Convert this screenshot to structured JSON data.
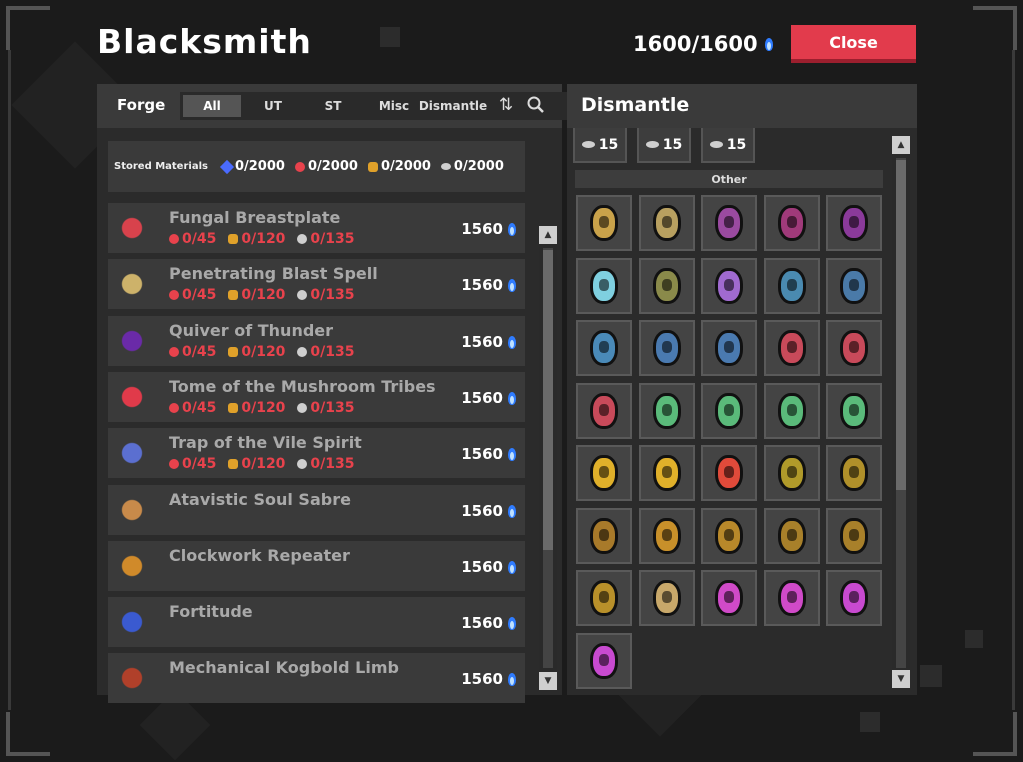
{
  "title": "Blacksmith",
  "currency": {
    "value": "1600/1600",
    "icon": "blue-flame-icon"
  },
  "close_label": "Close",
  "forge": {
    "label": "Forge",
    "tabs": [
      "All",
      "UT",
      "ST",
      "Misc",
      "Dismantle"
    ],
    "active_tab": "All",
    "icons": [
      "sort-icon",
      "search-icon"
    ]
  },
  "stored_materials": {
    "label": "Stored Materials",
    "items": [
      {
        "icon": "blue-crystal-icon",
        "value": "0/2000",
        "color": "#4a6bff"
      },
      {
        "icon": "red-heart-icon",
        "value": "0/2000",
        "color": "#e8424c"
      },
      {
        "icon": "gold-ore-icon",
        "value": "0/2000",
        "color": "#e0a12a"
      },
      {
        "icon": "silver-ore-icon",
        "value": "0/2000",
        "color": "#cfcfcf"
      }
    ]
  },
  "items": [
    {
      "name": "Fungal Breastplate",
      "req": [
        "0/45",
        "0/120",
        "0/135"
      ],
      "cost": "1560",
      "color": "#d8424c"
    },
    {
      "name": "Penetrating Blast Spell",
      "req": [
        "0/45",
        "0/120",
        "0/135"
      ],
      "cost": "1560",
      "color": "#cdb26a"
    },
    {
      "name": "Quiver of Thunder",
      "req": [
        "0/45",
        "0/120",
        "0/135"
      ],
      "cost": "1560",
      "color": "#6a2aa8"
    },
    {
      "name": "Tome of the Mushroom Tribes",
      "req": [
        "0/45",
        "0/120",
        "0/135"
      ],
      "cost": "1560",
      "color": "#e03a4a"
    },
    {
      "name": "Trap of the Vile Spirit",
      "req": [
        "0/45",
        "0/120",
        "0/135"
      ],
      "cost": "1560",
      "color": "#5b6fd0"
    },
    {
      "name": "Atavistic Soul Sabre",
      "req": [],
      "cost": "1560",
      "color": "#c88a4a"
    },
    {
      "name": "Clockwork Repeater",
      "req": [],
      "cost": "1560",
      "color": "#d08a2a"
    },
    {
      "name": "Fortitude",
      "req": [],
      "cost": "1560",
      "color": "#3a5ad0"
    },
    {
      "name": "Mechanical Kogbold Limb",
      "req": [],
      "cost": "1560",
      "color": "#b0402a"
    }
  ],
  "dismantle": {
    "title": "Dismantle",
    "material_slots": [
      "15",
      "15",
      "15"
    ],
    "other_label": "Other",
    "runes": [
      "#c9a24a",
      "#b8a060",
      "#9a4aa0",
      "#a03a7a",
      "#8a3a9a",
      "#7fd0e0",
      "#8a8a4a",
      "#a06ad0",
      "#4a8ab0",
      "#4a7aa8",
      "#4a8ab8",
      "#4a7ab0",
      "#4a7ab0",
      "#c84a5a",
      "#c84a5a",
      "#c84a5a",
      "#5aba7a",
      "#5aba7a",
      "#5aba7a",
      "#5aba7a",
      "#e0b02a",
      "#e0b02a",
      "#e04a3a",
      "#b09a2a",
      "#b0902a",
      "#a87a2a",
      "#c8902a",
      "#b8882a",
      "#a8802a",
      "#a8802a",
      "#b8902a",
      "#c8a86a",
      "#d04ac8",
      "#d04ac8",
      "#c84ad0",
      "#c84ad0"
    ]
  }
}
